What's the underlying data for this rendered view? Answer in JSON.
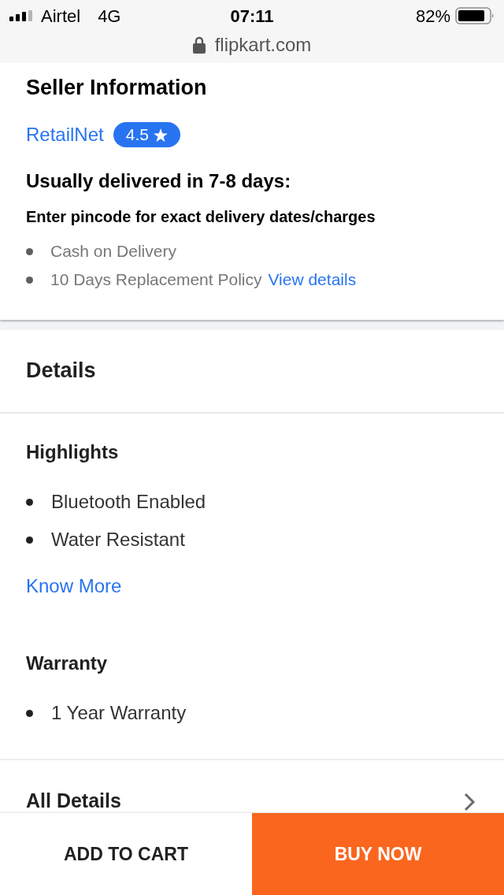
{
  "status_bar": {
    "carrier": "Airtel",
    "network": "4G",
    "time": "07:11",
    "battery": "82%"
  },
  "browser": {
    "url": "flipkart.com",
    "secure": true
  },
  "seller": {
    "title": "Seller Information",
    "name": "RetailNet",
    "rating": "4.5",
    "delivery": "Usually delivered in 7-8 days:",
    "pincode_note": "Enter pincode for exact delivery dates/charges",
    "features": [
      {
        "text": "Cash on Delivery"
      },
      {
        "text": "10 Days Replacement Policy",
        "link": "View details"
      }
    ]
  },
  "details": {
    "title": "Details",
    "sections": [
      {
        "title": "Highlights",
        "items": [
          "Bluetooth Enabled",
          "Water Resistant"
        ],
        "link": "Know More"
      },
      {
        "title": "Warranty",
        "items": [
          "1 Year Warranty"
        ]
      }
    ],
    "all_details": "All Details"
  },
  "actions": [
    {
      "label": "ADD TO CART",
      "kind": "secondary"
    },
    {
      "label": "BUY NOW",
      "kind": "primary"
    }
  ]
}
